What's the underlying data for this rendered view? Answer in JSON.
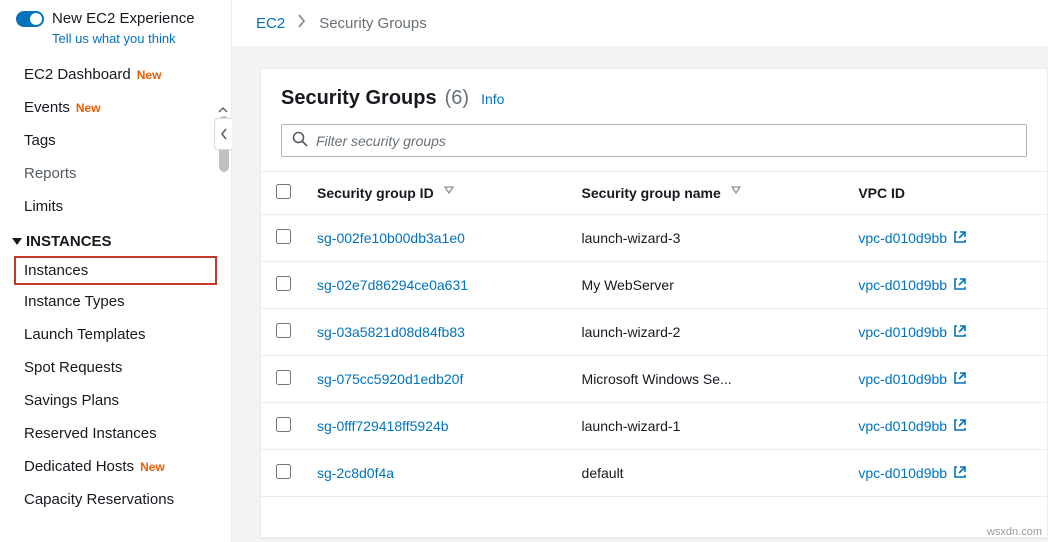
{
  "sidebar": {
    "experience_title": "New EC2 Experience",
    "feedback": "Tell us what you think",
    "top_items": [
      {
        "label": "EC2 Dashboard",
        "new": true
      },
      {
        "label": "Events",
        "new": true
      },
      {
        "label": "Tags",
        "new": false
      },
      {
        "label": "Reports",
        "new": false
      },
      {
        "label": "Limits",
        "new": false
      }
    ],
    "section_instances": "INSTANCES",
    "instances_items": [
      {
        "label": "Instances",
        "highlight": true,
        "new": false
      },
      {
        "label": "Instance Types",
        "new": false
      },
      {
        "label": "Launch Templates",
        "new": false
      },
      {
        "label": "Spot Requests",
        "new": false
      },
      {
        "label": "Savings Plans",
        "new": false
      },
      {
        "label": "Reserved Instances",
        "new": false
      },
      {
        "label": "Dedicated Hosts",
        "new": true
      },
      {
        "label": "Capacity Reservations",
        "new": false
      }
    ],
    "new_badge": "New"
  },
  "breadcrumb": {
    "root": "EC2",
    "current": "Security Groups"
  },
  "panel": {
    "title": "Security Groups",
    "count": "(6)",
    "info": "Info",
    "filter_placeholder": "Filter security groups",
    "columns": {
      "id": "Security group ID",
      "name": "Security group name",
      "vpc": "VPC ID"
    },
    "rows": [
      {
        "id": "sg-002fe10b00db3a1e0",
        "name": "launch-wizard-3",
        "vpc": "vpc-d010d9bb"
      },
      {
        "id": "sg-02e7d86294ce0a631",
        "name": "My WebServer",
        "vpc": "vpc-d010d9bb"
      },
      {
        "id": "sg-03a5821d08d84fb83",
        "name": "launch-wizard-2",
        "vpc": "vpc-d010d9bb"
      },
      {
        "id": "sg-075cc5920d1edb20f",
        "name": "Microsoft Windows Se...",
        "vpc": "vpc-d010d9bb"
      },
      {
        "id": "sg-0fff729418ff5924b",
        "name": "launch-wizard-1",
        "vpc": "vpc-d010d9bb"
      },
      {
        "id": "sg-2c8d0f4a",
        "name": "default",
        "vpc": "vpc-d010d9bb"
      }
    ]
  },
  "watermark": "wsxdn.com"
}
